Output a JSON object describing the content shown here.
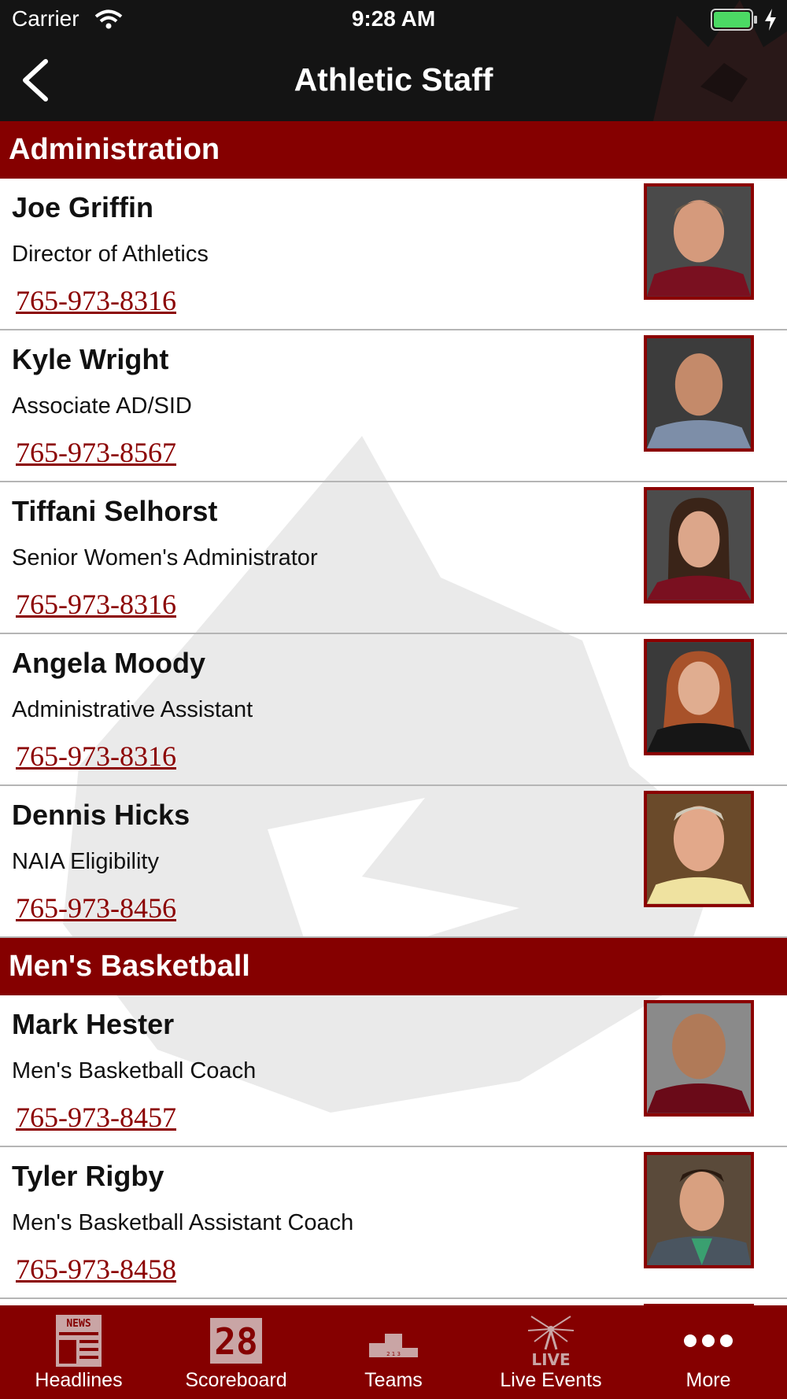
{
  "status_bar": {
    "carrier": "Carrier",
    "time": "9:28 AM"
  },
  "header": {
    "title": "Athletic Staff"
  },
  "colors": {
    "accent": "#850000",
    "header_bg": "#141414",
    "phone_link": "#8b0000"
  },
  "sections": [
    {
      "title": "Administration",
      "staff": [
        {
          "name": "Joe Griffin",
          "title": "Director of Athletics",
          "phone": "765-973-8316"
        },
        {
          "name": "Kyle Wright",
          "title": "Associate AD/SID",
          "phone": "765-973-8567"
        },
        {
          "name": "Tiffani Selhorst",
          "title": "Senior Women's Administrator",
          "phone": "765-973-8316"
        },
        {
          "name": "Angela Moody",
          "title": "Administrative Assistant",
          "phone": "765-973-8316"
        },
        {
          "name": "Dennis Hicks",
          "title": "NAIA Eligibility",
          "phone": "765-973-8456"
        }
      ]
    },
    {
      "title": "Men's Basketball",
      "staff": [
        {
          "name": "Mark Hester",
          "title": "Men's Basketball Coach",
          "phone": "765-973-8457"
        },
        {
          "name": "Tyler Rigby",
          "title": "Men's Basketball Assistant Coach",
          "phone": "765-973-8458"
        }
      ]
    }
  ],
  "tab_bar": {
    "tabs": [
      {
        "label": "Headlines",
        "icon": "news-icon"
      },
      {
        "label": "Scoreboard",
        "icon": "scoreboard-icon"
      },
      {
        "label": "Teams",
        "icon": "podium-icon"
      },
      {
        "label": "Live Events",
        "icon": "live-icon"
      },
      {
        "label": "More",
        "icon": "more-dots-icon"
      }
    ],
    "icon_text": {
      "news": "NEWS",
      "scoreboard": "28",
      "live": "LIVE",
      "podium_places": "2 1 3"
    }
  }
}
